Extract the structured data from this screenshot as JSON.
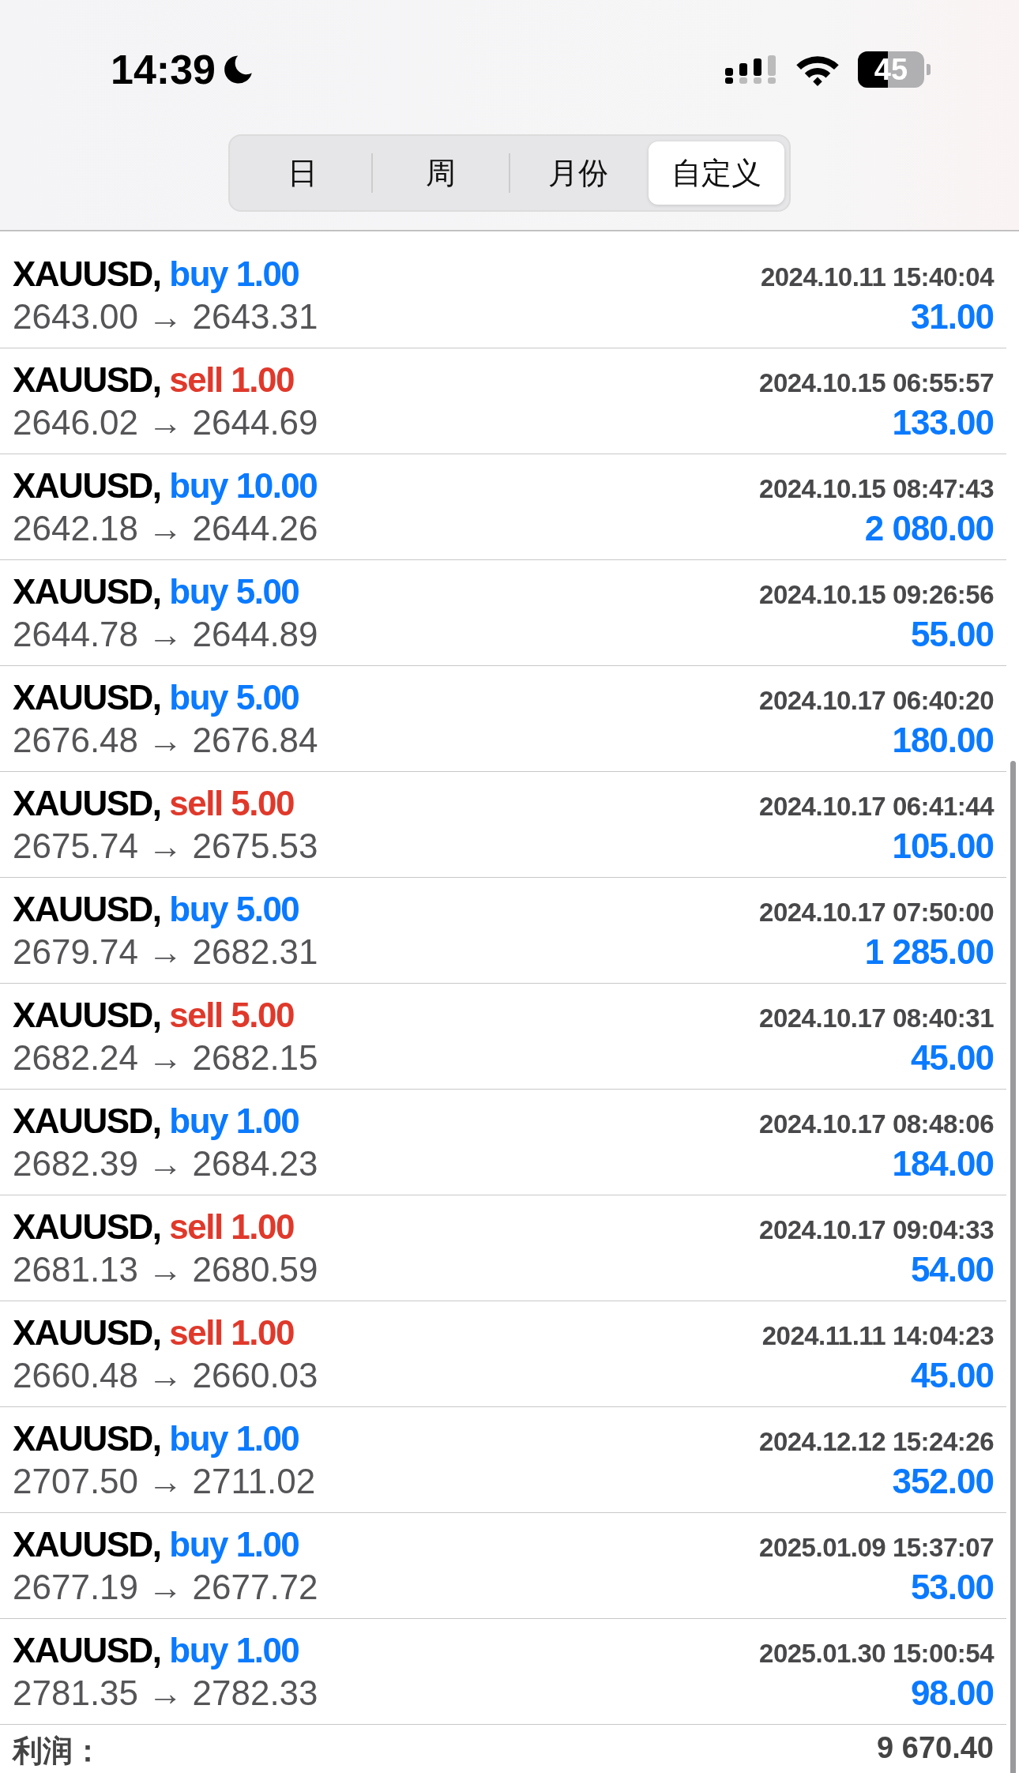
{
  "status_bar": {
    "time": "14:39",
    "battery": "45"
  },
  "tabs": [
    {
      "label": "日",
      "selected": false
    },
    {
      "label": "周",
      "selected": false
    },
    {
      "label": "月份",
      "selected": false
    },
    {
      "label": "自定义",
      "selected": true
    }
  ],
  "trades": [
    {
      "symbol": "XAUUSD,",
      "side": "buy",
      "lots": "1.00",
      "time": "2024.10.11 15:40:04",
      "prices": "2643.00 → 2643.31",
      "profit": "31.00"
    },
    {
      "symbol": "XAUUSD,",
      "side": "sell",
      "lots": "1.00",
      "time": "2024.10.15 06:55:57",
      "prices": "2646.02 → 2644.69",
      "profit": "133.00"
    },
    {
      "symbol": "XAUUSD,",
      "side": "buy",
      "lots": "10.00",
      "time": "2024.10.15 08:47:43",
      "prices": "2642.18 → 2644.26",
      "profit": "2 080.00"
    },
    {
      "symbol": "XAUUSD,",
      "side": "buy",
      "lots": "5.00",
      "time": "2024.10.15 09:26:56",
      "prices": "2644.78 → 2644.89",
      "profit": "55.00"
    },
    {
      "symbol": "XAUUSD,",
      "side": "buy",
      "lots": "5.00",
      "time": "2024.10.17 06:40:20",
      "prices": "2676.48 → 2676.84",
      "profit": "180.00"
    },
    {
      "symbol": "XAUUSD,",
      "side": "sell",
      "lots": "5.00",
      "time": "2024.10.17 06:41:44",
      "prices": "2675.74 → 2675.53",
      "profit": "105.00"
    },
    {
      "symbol": "XAUUSD,",
      "side": "buy",
      "lots": "5.00",
      "time": "2024.10.17 07:50:00",
      "prices": "2679.74 → 2682.31",
      "profit": "1 285.00"
    },
    {
      "symbol": "XAUUSD,",
      "side": "sell",
      "lots": "5.00",
      "time": "2024.10.17 08:40:31",
      "prices": "2682.24 → 2682.15",
      "profit": "45.00"
    },
    {
      "symbol": "XAUUSD,",
      "side": "buy",
      "lots": "1.00",
      "time": "2024.10.17 08:48:06",
      "prices": "2682.39 → 2684.23",
      "profit": "184.00"
    },
    {
      "symbol": "XAUUSD,",
      "side": "sell",
      "lots": "1.00",
      "time": "2024.10.17 09:04:33",
      "prices": "2681.13 → 2680.59",
      "profit": "54.00"
    },
    {
      "symbol": "XAUUSD,",
      "side": "sell",
      "lots": "1.00",
      "time": "2024.11.11 14:04:23",
      "prices": "2660.48 → 2660.03",
      "profit": "45.00"
    },
    {
      "symbol": "XAUUSD,",
      "side": "buy",
      "lots": "1.00",
      "time": "2024.12.12 15:24:26",
      "prices": "2707.50 → 2711.02",
      "profit": "352.00"
    },
    {
      "symbol": "XAUUSD,",
      "side": "buy",
      "lots": "1.00",
      "time": "2025.01.09 15:37:07",
      "prices": "2677.19 → 2677.72",
      "profit": "53.00"
    },
    {
      "symbol": "XAUUSD,",
      "side": "buy",
      "lots": "1.00",
      "time": "2025.01.30 15:00:54",
      "prices": "2781.35 → 2782.33",
      "profit": "98.00"
    }
  ],
  "total": {
    "label": "利润：",
    "value": "9 670.40"
  }
}
